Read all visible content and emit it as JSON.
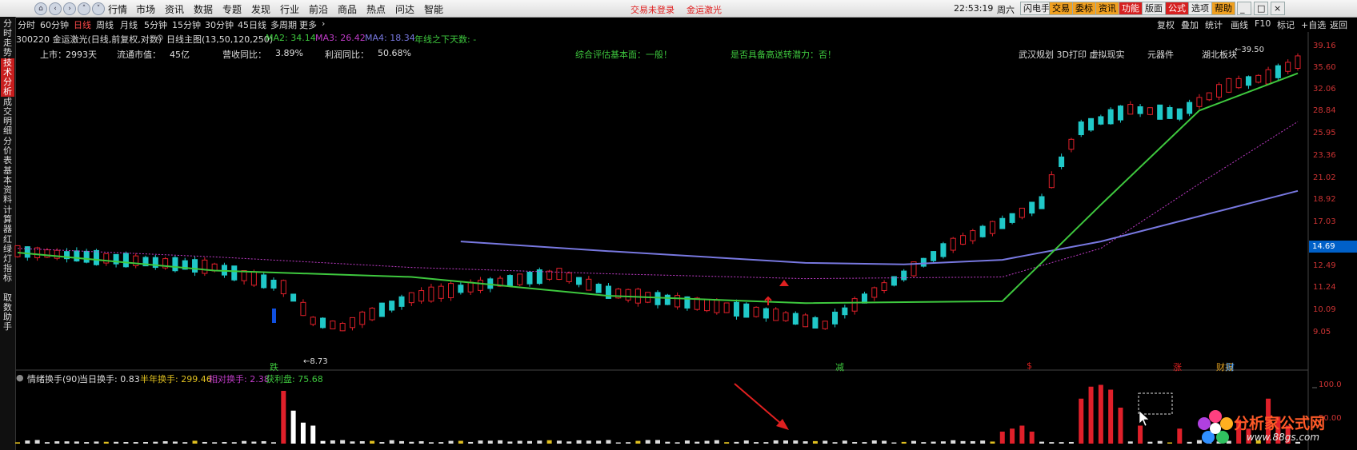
{
  "top_menu": {
    "items": [
      "行情",
      "市场",
      "资讯",
      "数据",
      "专题",
      "发现",
      "行业",
      "前沿",
      "商品",
      "热点",
      "问达",
      "智能"
    ],
    "alert": "交易未登录",
    "stock_name": "金运激光",
    "clock": "22:53:19",
    "weekday": "周六",
    "tool_buttons": [
      "闪电手",
      "交易",
      "委标",
      "资讯",
      "功能",
      "版面",
      "公式",
      "选项",
      "帮助"
    ]
  },
  "period_tabs": [
    "分时",
    "60分钟",
    "日线",
    "周线",
    "月线",
    "5分钟",
    "15分钟",
    "30分钟",
    "45日线",
    "多周期",
    "更多"
  ],
  "active_tab": "日线",
  "right_tools": [
    "复权",
    "叠加",
    "统计",
    "画线",
    "F10",
    "标记",
    "+自选",
    "返回"
  ],
  "sidebar": {
    "tabs": [
      "分时走势",
      "技术分析",
      "成交明细",
      "分价表",
      "基本资料",
      "计算器",
      "红绿灯指标",
      "取数助手"
    ],
    "active": "技术分析"
  },
  "chart_header": {
    "code_line": "300220 金运激光(日线,前复权,对数)",
    "main_label": "日线主图(13,50,120,250)",
    "ma2": "MA2: 34.14",
    "ma3": "MA3: 26.42",
    "ma4": "MA4: 18.34",
    "extra": "年线之下天数: -"
  },
  "info_row": {
    "listed_label": "上市：",
    "listed": "2993天",
    "float_label": "流通市值：",
    "float_value": "45亿",
    "rev_label": "营收同比：",
    "rev": "3.89%",
    "profit_label": "利润同比：",
    "profit": "50.68%",
    "eval": "综合评估基本面：一般！",
    "potential": "是否具备高送转潜力：否！",
    "concepts": "武汉规划  3D打印  虚拟现实",
    "concepts2": "元器件",
    "concepts3": "湖北板块"
  },
  "price_axis": [
    "39.16",
    "35.60",
    "32.06",
    "28.84",
    "25.95",
    "23.36",
    "21.02",
    "18.92",
    "17.03",
    "14.69",
    "12.49",
    "11.24",
    "10.09",
    "9.05"
  ],
  "current_price": "14.69",
  "annotations": {
    "low_label": "8.73",
    "high_label": "39.50",
    "signal_die": "跌",
    "signal_jian": "减",
    "signal_dollar": "$",
    "signal_zhang": "涨",
    "signal_caibao": "财报",
    "signal_cai2": "财"
  },
  "indicator": {
    "name": "情绪换手(90)",
    "today": "当日换手: 0.83",
    "half_year": "半年换手: 299.46",
    "relative": "相对换手: 2.38",
    "profit_chip": "获利盘: 75.68",
    "axis": [
      "100.0",
      "50.00"
    ]
  },
  "logo": {
    "name": "分析家公式网",
    "url": "www.88gs.com"
  },
  "colors": {
    "ma2": "#3ec83e",
    "ma3": "#c03cc8",
    "ma4": "#7878e0",
    "up": "#e0202a",
    "down": "#20c8c8",
    "accent": "#d62020"
  },
  "chart_data": {
    "type": "line",
    "title": "300220 金运激光(日线,前复权,对数)",
    "series": [
      {
        "name": "MA2",
        "x": [
          0,
          20,
          40,
          60,
          80,
          100,
          110,
          120,
          130
        ],
        "values": [
          13.2,
          12.0,
          11.6,
          10.5,
          10.1,
          10.2,
          17.0,
          28.0,
          34.1
        ]
      },
      {
        "name": "MA3",
        "x": [
          0,
          20,
          40,
          60,
          80,
          100,
          110,
          120,
          130
        ],
        "values": [
          13.5,
          12.9,
          12.2,
          11.8,
          11.5,
          11.6,
          13.5,
          19.0,
          26.4
        ]
      },
      {
        "name": "MA4",
        "x": [
          45,
          60,
          80,
          90,
          100,
          110,
          120,
          130
        ],
        "values": [
          14.0,
          13.3,
          12.5,
          12.4,
          12.7,
          14.0,
          16.0,
          18.3
        ]
      }
    ],
    "ylim": [
      8.5,
      40
    ],
    "scale": "log",
    "last_close": 36.2,
    "low": 8.73,
    "high": 39.5
  }
}
